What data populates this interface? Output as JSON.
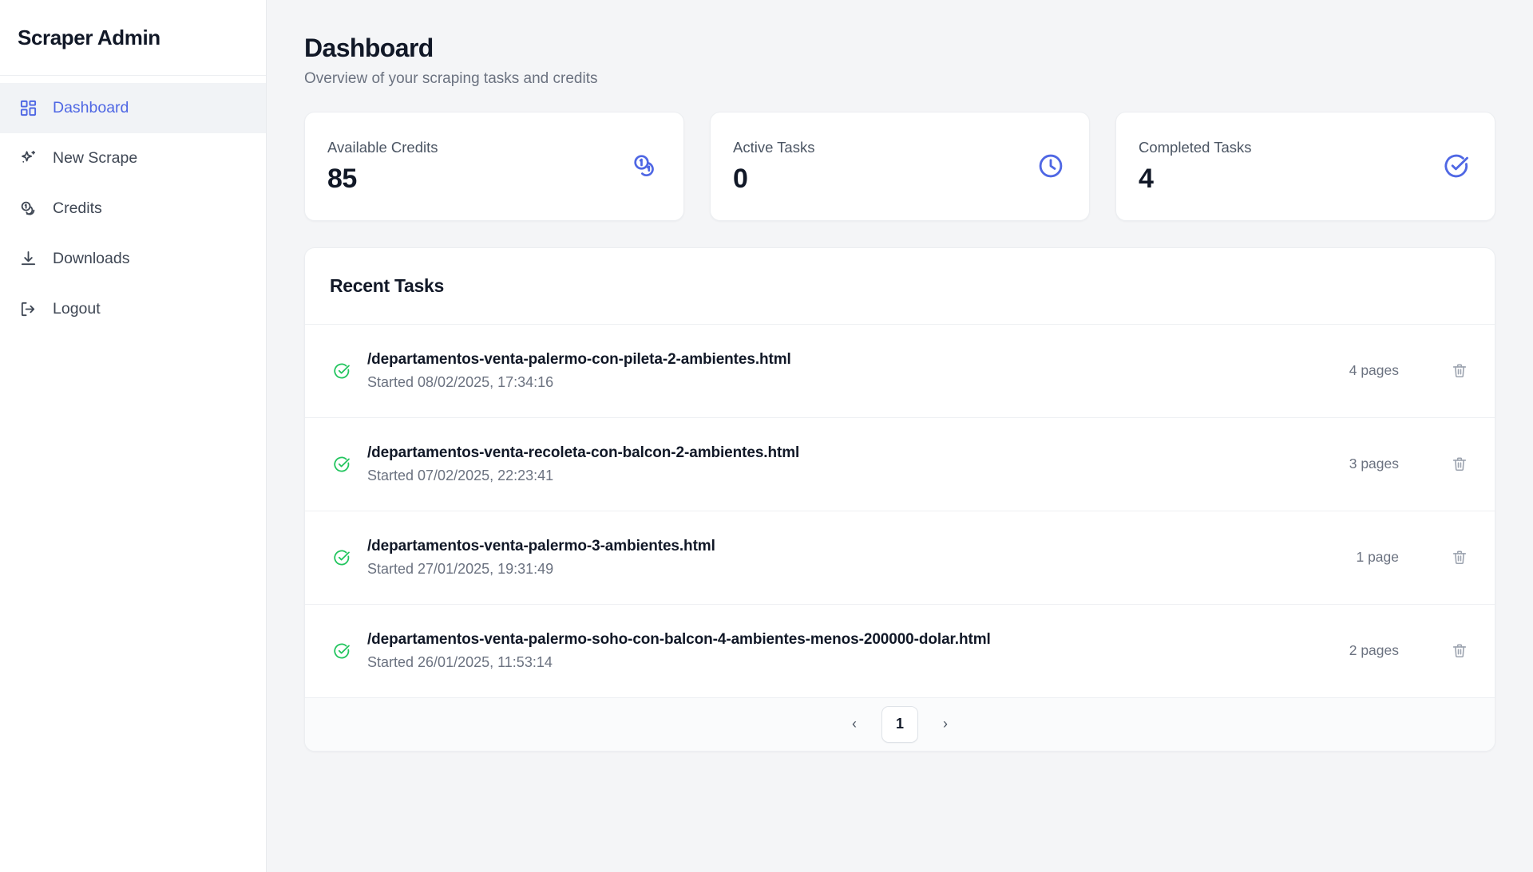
{
  "sidebar": {
    "brand": "Scraper Admin",
    "items": [
      {
        "label": "Dashboard",
        "icon": "layout-grid-icon",
        "active": true
      },
      {
        "label": "New Scrape",
        "icon": "sparkles-icon",
        "active": false
      },
      {
        "label": "Credits",
        "icon": "coins-icon",
        "active": false
      },
      {
        "label": "Downloads",
        "icon": "download-icon",
        "active": false
      },
      {
        "label": "Logout",
        "icon": "logout-icon",
        "active": false
      }
    ]
  },
  "header": {
    "title": "Dashboard",
    "subtitle": "Overview of your scraping tasks and credits"
  },
  "stats": [
    {
      "label": "Available Credits",
      "value": "85",
      "icon": "coins-icon"
    },
    {
      "label": "Active Tasks",
      "value": "0",
      "icon": "clock-icon"
    },
    {
      "label": "Completed Tasks",
      "value": "4",
      "icon": "circle-check-icon"
    }
  ],
  "recent_tasks": {
    "title": "Recent Tasks",
    "rows": [
      {
        "status": "completed",
        "name": "/departamentos-venta-palermo-con-pileta-2-ambientes.html",
        "started": "Started 08/02/2025, 17:34:16",
        "pages": "4 pages"
      },
      {
        "status": "completed",
        "name": "/departamentos-venta-recoleta-con-balcon-2-ambientes.html",
        "started": "Started 07/02/2025, 22:23:41",
        "pages": "3 pages"
      },
      {
        "status": "completed",
        "name": "/departamentos-venta-palermo-3-ambientes.html",
        "started": "Started 27/01/2025, 19:31:49",
        "pages": "1 page"
      },
      {
        "status": "completed",
        "name": "/departamentos-venta-palermo-soho-con-balcon-4-ambientes-menos-200000-dolar.html",
        "started": "Started 26/01/2025, 11:53:14",
        "pages": "2 pages"
      }
    ]
  },
  "pagination": {
    "prev_label": "‹",
    "current_page": "1",
    "next_label": "›"
  },
  "colors": {
    "accent": "#4f67e4",
    "success": "#22c55e",
    "page_bg": "#f4f5f7",
    "card_bg": "#ffffff",
    "muted_text": "#6b7280"
  }
}
